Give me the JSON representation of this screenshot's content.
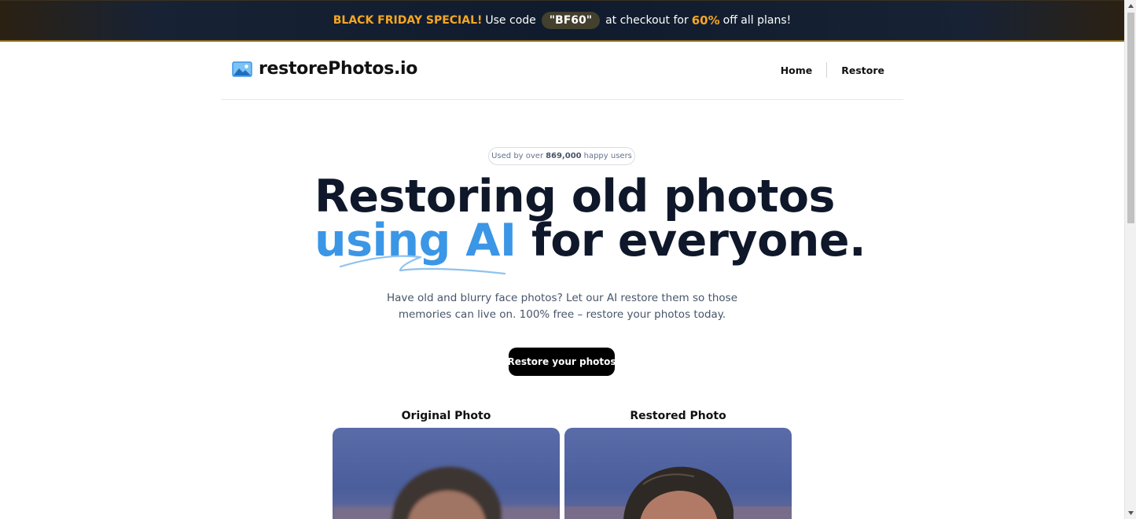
{
  "promo": {
    "special": "BLACK FRIDAY SPECIAL!",
    "use_code": "Use code",
    "code": "\"BF60\"",
    "at_checkout": "at checkout for",
    "percent": "60%",
    "tail": "off all plans!"
  },
  "header": {
    "logo_text": "restorePhotos.io",
    "nav": [
      "Home",
      "Restore"
    ]
  },
  "hero": {
    "pill_prefix": "Used by over",
    "pill_count": "869,000",
    "pill_suffix": "happy users",
    "headline_line1": "Restoring old photos",
    "headline_highlight": "using AI",
    "headline_rest": " for everyone.",
    "subtext": "Have old and blurry face photos? Let our AI restore them so those memories can live on. 100% free – restore your photos today.",
    "cta": "Restore your photos"
  },
  "photos": {
    "original_label": "Original Photo",
    "restored_label": "Restored Photo"
  },
  "colors": {
    "accent": "#3b96e6",
    "promo_highlight": "#f5a623",
    "text_dark": "#0f172a",
    "cta_bg": "#000000"
  },
  "icons": {
    "logo": "landscape-photo-icon",
    "scroll_up": "chevron-up-icon",
    "scroll_down": "chevron-down-icon"
  }
}
